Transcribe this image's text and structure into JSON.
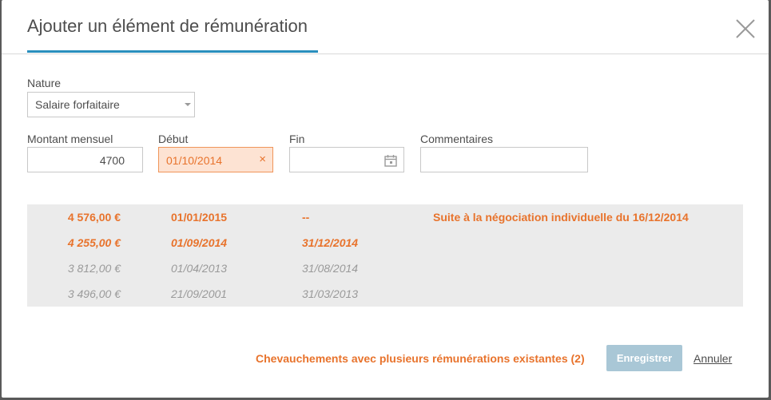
{
  "modal": {
    "title": "Ajouter un élément de rémunération",
    "close_icon": "close-icon"
  },
  "form": {
    "nature": {
      "label": "Nature",
      "value": "Salaire forfaitaire"
    },
    "monthly_amount": {
      "label": "Montant mensuel",
      "value": "4700"
    },
    "start_date": {
      "label": "Début",
      "value": "01/10/2014",
      "clear_glyph": "×"
    },
    "end_date": {
      "label": "Fin",
      "value": "",
      "icon": "calendar-icon"
    },
    "comments": {
      "label": "Commentaires",
      "value": ""
    }
  },
  "history": [
    {
      "amount": "4 576,00 €",
      "start": "01/01/2015",
      "end": "--",
      "comment": "Suite à la négociation individuelle du 16/12/2014",
      "state": "current"
    },
    {
      "amount": "4 255,00 €",
      "start": "01/09/2014",
      "end": "31/12/2014",
      "comment": "",
      "state": "overlap"
    },
    {
      "amount": "3 812,00 €",
      "start": "01/04/2013",
      "end": "31/08/2014",
      "comment": "",
      "state": "past"
    },
    {
      "amount": "3 496,00 €",
      "start": "21/09/2001",
      "end": "31/03/2013",
      "comment": "",
      "state": "past"
    }
  ],
  "footer": {
    "warning": "Chevauchements avec plusieurs rémunérations existantes (2)",
    "save_label": "Enregistrer",
    "cancel_label": "Annuler"
  },
  "colors": {
    "accent": "#2a8fbd",
    "warning": "#e8732c",
    "save_disabled": "#a9c7d6",
    "history_bg": "#ebebeb"
  }
}
